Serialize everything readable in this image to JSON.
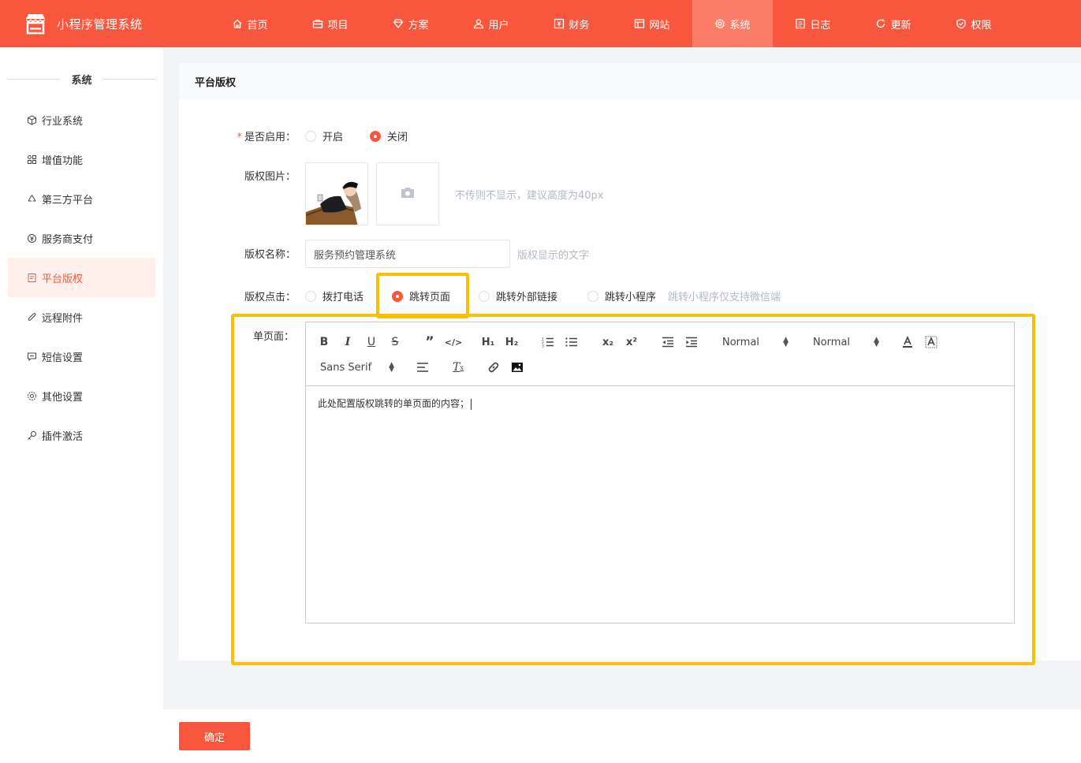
{
  "app": {
    "title": "小程序管理系统",
    "logo_icon": "shop-icon"
  },
  "nav": [
    {
      "label": "首页",
      "icon": "home-icon"
    },
    {
      "label": "项目",
      "icon": "briefcase-icon"
    },
    {
      "label": "方案",
      "icon": "diamond-icon"
    },
    {
      "label": "用户",
      "icon": "users-icon"
    },
    {
      "label": "财务",
      "icon": "finance-icon"
    },
    {
      "label": "网站",
      "icon": "website-icon"
    },
    {
      "label": "系统",
      "icon": "gear-icon",
      "active": true
    },
    {
      "label": "日志",
      "icon": "log-icon"
    },
    {
      "label": "更新",
      "icon": "refresh-icon"
    },
    {
      "label": "权限",
      "icon": "shield-check-icon"
    }
  ],
  "sidebar": {
    "title": "系统",
    "items": [
      {
        "label": "行业系统",
        "icon": "cube-icon"
      },
      {
        "label": "增值功能",
        "icon": "grid-icon"
      },
      {
        "label": "第三方平台",
        "icon": "recycle-icon"
      },
      {
        "label": "服务商支付",
        "icon": "payment-icon"
      },
      {
        "label": "平台版权",
        "icon": "copyright-doc-icon",
        "active": true
      },
      {
        "label": "远程附件",
        "icon": "paperclip-icon"
      },
      {
        "label": "短信设置",
        "icon": "message-icon"
      },
      {
        "label": "其他设置",
        "icon": "settings-icon"
      },
      {
        "label": "插件激活",
        "icon": "key-icon"
      }
    ]
  },
  "card": {
    "title": "平台版权"
  },
  "form": {
    "enabled": {
      "label": "是否启用：",
      "required_mark": "*",
      "options": [
        "开启",
        "关闭"
      ],
      "selected": "关闭"
    },
    "image": {
      "label": "版权图片：",
      "hint": "不传则不显示，建议高度为40px",
      "upload_icon": "camera-icon"
    },
    "name": {
      "label": "版权名称：",
      "value": "服务预约管理系统",
      "hint": "版权显示的文字"
    },
    "click": {
      "label": "版权点击：",
      "options": [
        "拨打电话",
        "跳转页面",
        "跳转外部链接",
        "跳转小程序"
      ],
      "selected": "跳转页面",
      "hint": "跳转小程序仅支持微信端"
    },
    "page": {
      "label": "单页面："
    }
  },
  "editor": {
    "header_select": "Normal",
    "size_select": "Normal",
    "font_select": "Sans Serif",
    "content": "此处配置版权跳转的单页面的内容；"
  },
  "footer": {
    "confirm_label": "确定"
  },
  "colors": {
    "brand": "#f9573d",
    "highlight": "#fbbf0a",
    "active_nav": "#fb7d68"
  }
}
